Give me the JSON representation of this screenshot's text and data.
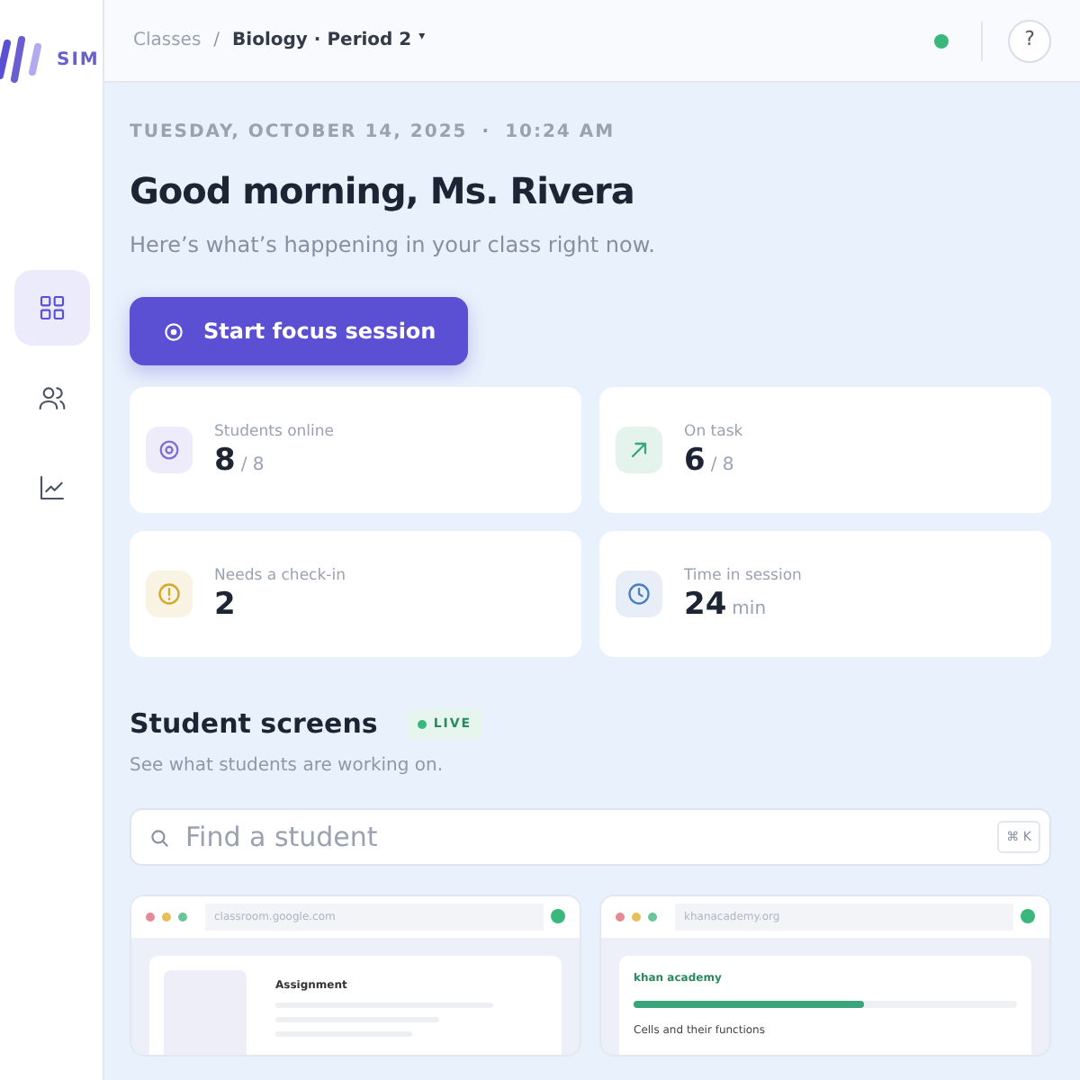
{
  "sidebar": {
    "logo_text": "SIM",
    "items": [
      {
        "kind": "grid",
        "selected": true
      },
      {
        "kind": "users",
        "selected": false
      },
      {
        "kind": "chart",
        "selected": false
      }
    ]
  },
  "header": {
    "breadcrumb": [
      "Classes",
      "Biology · Period 2"
    ],
    "breadcrumb_separator": "/",
    "dropdown_caret": "▾",
    "help": "?"
  },
  "date_line": {
    "date": "TUESDAY, OCTOBER 14, 2025",
    "separator": "·",
    "time": "10:24 AM"
  },
  "greeting": "Good morning, Ms. Rivera",
  "subtitle": "Here’s what’s happening in your class right now.",
  "primary_button": "Start focus session",
  "stats": [
    {
      "kind": "target",
      "color": "#7c6fd6",
      "label": "Students online",
      "value": "8",
      "suffix": "/ 8"
    },
    {
      "kind": "arrow",
      "color": "#3aa57a",
      "label": "On task",
      "value": "6",
      "suffix": "/ 8"
    },
    {
      "kind": "alert",
      "color": "#d4a72c",
      "label": "Needs a check-in",
      "value": "2"
    },
    {
      "kind": "clock",
      "color": "#4a7fc1",
      "label": "Time in session",
      "value": "24",
      "suffix": "min"
    }
  ],
  "screens_section": {
    "title": "Student screens",
    "badge": "LIVE",
    "subtitle": "See what students are working on.",
    "search": {
      "placeholder": "Find a student",
      "shortcut": "⌘ K"
    },
    "screens": [
      {
        "url": "classroom.google.com",
        "online": true,
        "kind": "assignment",
        "heading": "Assignment"
      },
      {
        "url": "khanacademy.org",
        "online": true,
        "kind": "lesson",
        "heading": "khan academy",
        "level": 0.6,
        "caption": "Cells and their functions"
      }
    ]
  }
}
